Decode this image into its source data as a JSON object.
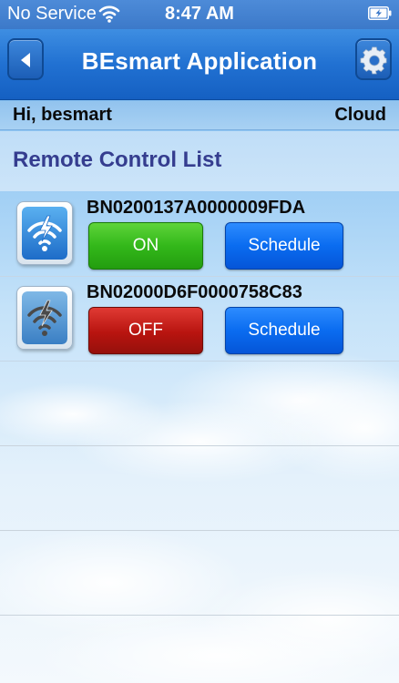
{
  "status_bar": {
    "carrier": "No Service",
    "time": "8:47 AM",
    "wifi_icon": "wifi-icon",
    "battery_icon": "battery-charging-icon"
  },
  "nav": {
    "title": "BEsmart Application",
    "back_icon": "back-arrow-icon",
    "settings_icon": "gear-icon"
  },
  "user_bar": {
    "greeting": "Hi, besmart",
    "connection_mode": "Cloud"
  },
  "list": {
    "title": "Remote Control List",
    "items": [
      {
        "device_id": "BN0200137A0000009FDA",
        "status_label": "ON",
        "schedule_label": "Schedule",
        "icon": "wifi-device-online-icon",
        "status_color": "#2ab516"
      },
      {
        "device_id": "BN02000D6F0000758C83",
        "status_label": "OFF",
        "schedule_label": "Schedule",
        "icon": "wifi-device-offline-icon",
        "status_color": "#b8140f"
      }
    ]
  },
  "colors": {
    "nav_blue": "#2171d2",
    "section_title": "#353d8f",
    "schedule_blue": "#0a6cf0"
  }
}
